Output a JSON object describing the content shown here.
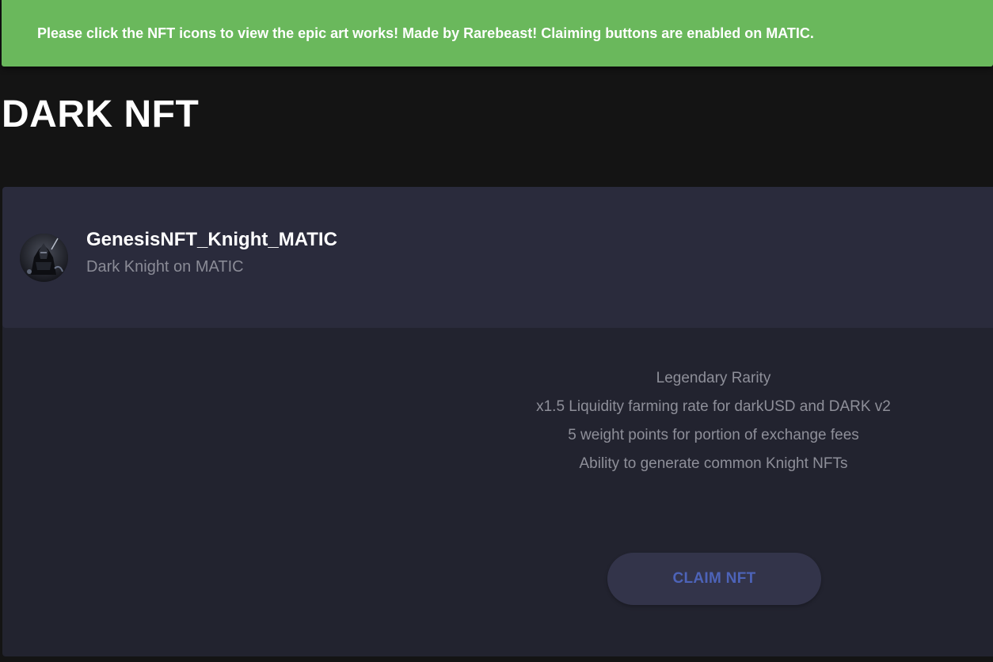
{
  "banner": {
    "text": "Please click the NFT icons to view the epic art works! Made by Rarebeast! Claiming buttons are enabled on MATIC.",
    "color": "#6ab85c"
  },
  "page": {
    "title": "DARK NFT",
    "background": "#141414"
  },
  "nft_card": {
    "avatar_icon": "knight-avatar",
    "title": "GenesisNFT_Knight_MATIC",
    "subtitle": "Dark Knight on MATIC",
    "features": [
      "Legendary Rarity",
      "x1.5 Liquidity farming rate for darkUSD and DARK v2",
      "5 weight points for portion of exchange fees",
      "Ability to generate common Knight NFTs"
    ],
    "claim_label": "CLAIM NFT",
    "claim_color": "#4d63b8"
  }
}
